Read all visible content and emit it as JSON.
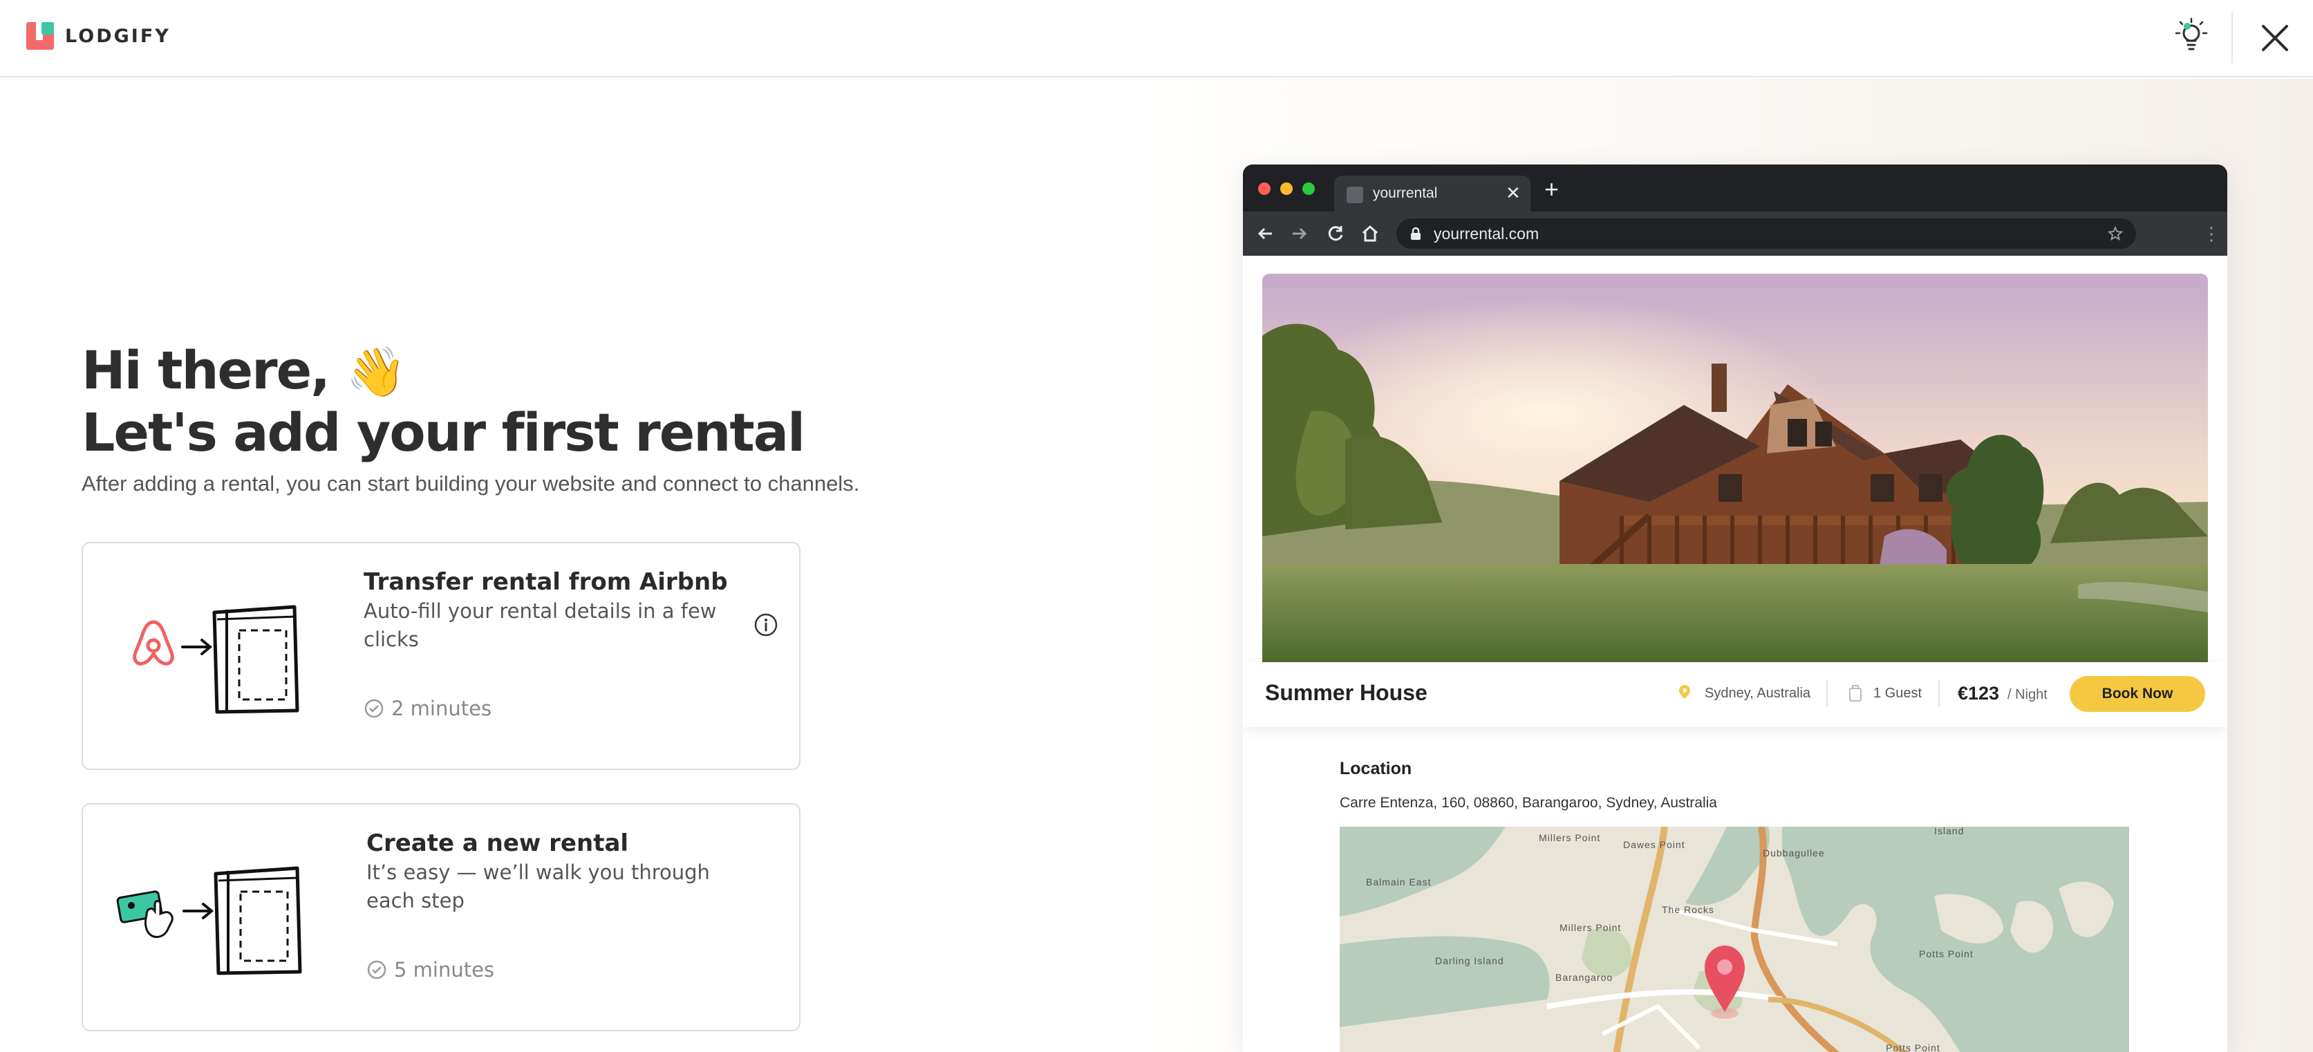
{
  "brand": {
    "name": "LODGIFY"
  },
  "header": {
    "tip_icon": "lightbulb-icon",
    "close_icon": "close-icon"
  },
  "hero": {
    "greeting": "Hi there,",
    "wave_emoji": "👋",
    "title": "Let's add your first rental",
    "subtitle": "After adding a rental, you can start building your website and connect to channels."
  },
  "options": [
    {
      "title": "Transfer rental from Airbnb",
      "description": "Auto-fill your rental details in a few clicks",
      "duration": "2 minutes"
    },
    {
      "title": "Create a new rental",
      "description": "It’s easy — we’ll walk you through each step",
      "duration": "5 minutes"
    }
  ],
  "preview": {
    "tab_title": "yourrental.com",
    "tab_label": "yourrental",
    "url": "yourrental.com",
    "property_name": "Summer House",
    "location": "Sydney, Australia",
    "guests": "1 Guest",
    "price": "€123",
    "per_night": "/ Night",
    "book_label": "Book Now",
    "location_heading": "Location",
    "address": "Carre Entenza, 160, 08860, Barangaroo, Sydney, Australia",
    "map_labels": [
      "Millers Point",
      "Dawes Point",
      "Dubbagullee",
      "Balmain East",
      "Millers Point",
      "The Rocks",
      "Darling Island",
      "Barangaroo",
      "Potts Point",
      "Island",
      "Potts Point"
    ]
  },
  "colors": {
    "accent_yellow": "#f5c842",
    "airbnb_red": "#f06262",
    "brand_coral": "#f26b6b",
    "brand_teal": "#3cc7a3"
  }
}
